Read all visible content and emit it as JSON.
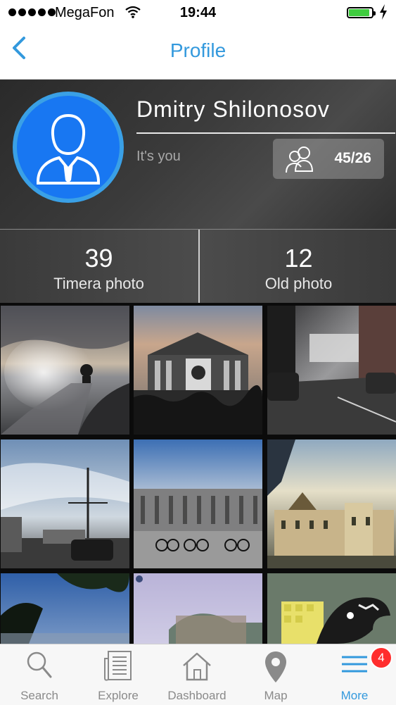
{
  "status_bar": {
    "carrier": "MegaFon",
    "time": "19:44",
    "battery_level": 0.9,
    "icons": [
      "signal-dots-icon",
      "wifi-icon",
      "battery-icon",
      "charging-bolt-icon"
    ]
  },
  "nav": {
    "title": "Profile",
    "back_icon": "chevron-left-icon",
    "accent_color": "#3399dd"
  },
  "profile": {
    "name": "Dmitry Shilonosov",
    "subtitle": "It's you",
    "friends_count": "45/26",
    "avatar_icon": "person-silhouette-icon",
    "avatar_color": "#1877f2"
  },
  "stats": [
    {
      "value": "39",
      "label": "Timera photo"
    },
    {
      "value": "12",
      "label": "Old photo"
    }
  ],
  "photos": [
    {
      "subject": "embankment-sunset"
    },
    {
      "subject": "historic-building-crowd"
    },
    {
      "subject": "city-street"
    },
    {
      "subject": "palace-bridge-lamp"
    },
    {
      "subject": "winter-palace-cyclists"
    },
    {
      "subject": "historic-facade"
    },
    {
      "subject": "trees-sky"
    },
    {
      "subject": "building-dome"
    },
    {
      "subject": "dinosaur-sticker"
    }
  ],
  "tabs": [
    {
      "label": "Search",
      "icon": "search-icon",
      "active": false
    },
    {
      "label": "Explore",
      "icon": "newspaper-icon",
      "active": false
    },
    {
      "label": "Dashboard",
      "icon": "house-icon",
      "active": false
    },
    {
      "label": "Map",
      "icon": "map-pin-icon",
      "active": false
    },
    {
      "label": "More",
      "icon": "menu-lines-icon",
      "active": true
    }
  ],
  "more_badge": "4"
}
